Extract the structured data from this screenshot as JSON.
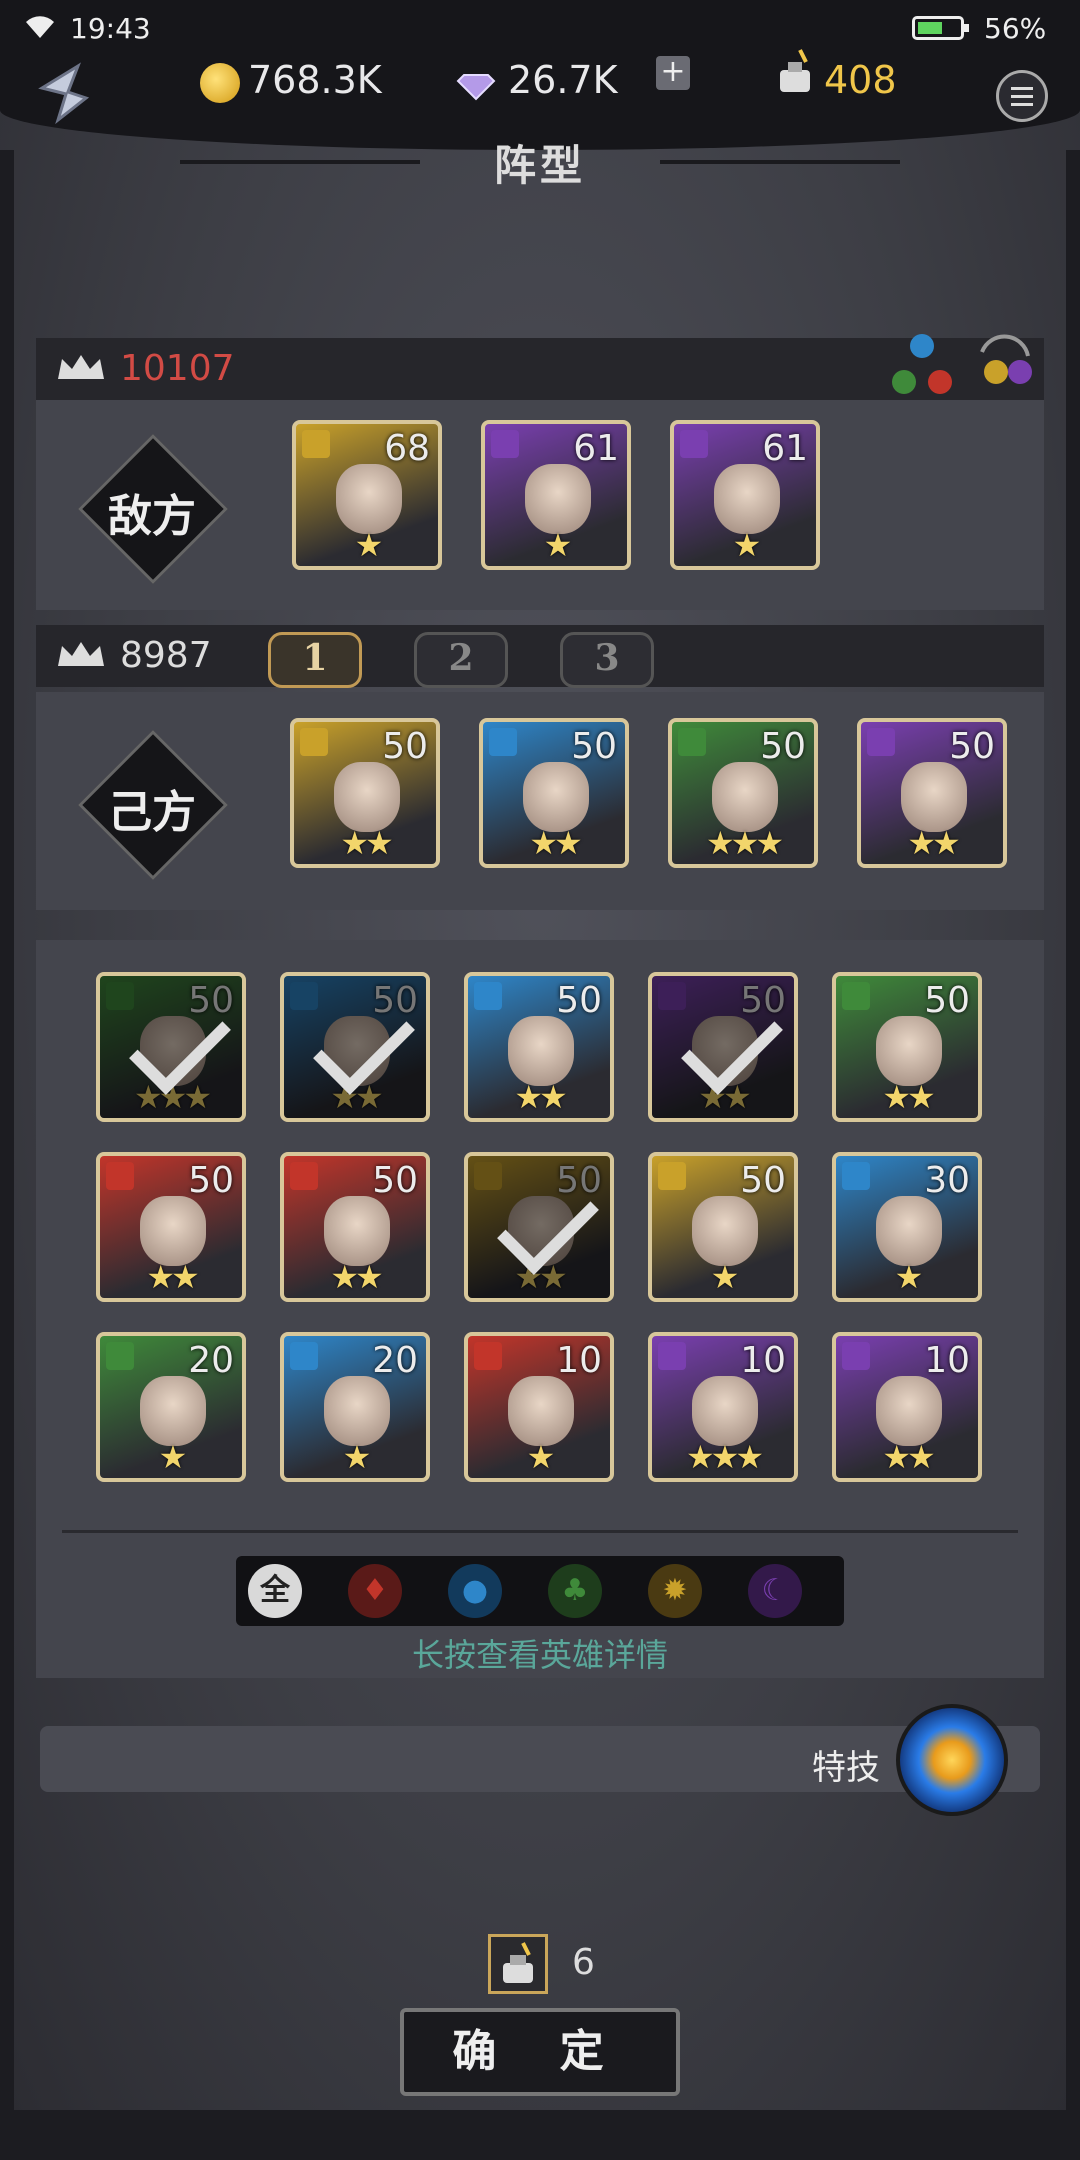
{
  "status_bar": {
    "time": "19:43",
    "battery": "56%"
  },
  "currency": {
    "gold": "768.3K",
    "gems": "26.7K",
    "ink": "408"
  },
  "page_title": "阵型",
  "enemy": {
    "label": "敌方",
    "power": "10107",
    "heroes": [
      {
        "level": "68",
        "stars": "★",
        "element": "light"
      },
      {
        "level": "61",
        "stars": "★",
        "element": "dark"
      },
      {
        "level": "61",
        "stars": "★",
        "element": "dark"
      }
    ]
  },
  "ally": {
    "label": "己方",
    "power": "8987",
    "team_tabs": [
      "1",
      "2",
      "3"
    ],
    "heroes": [
      {
        "level": "50",
        "stars": "★★",
        "element": "light"
      },
      {
        "level": "50",
        "stars": "★★",
        "element": "water"
      },
      {
        "level": "50",
        "stars": "★★★",
        "element": "nature"
      },
      {
        "level": "50",
        "stars": "★★",
        "element": "dark"
      }
    ]
  },
  "roster": [
    {
      "level": "50",
      "stars": "★★★",
      "element": "nature",
      "used": true
    },
    {
      "level": "50",
      "stars": "★★",
      "element": "water",
      "used": true
    },
    {
      "level": "50",
      "stars": "★★",
      "element": "water",
      "used": false
    },
    {
      "level": "50",
      "stars": "★★",
      "element": "dark",
      "used": true
    },
    {
      "level": "50",
      "stars": "★★",
      "element": "nature",
      "used": false
    },
    {
      "level": "50",
      "stars": "★★",
      "element": "fire",
      "used": false
    },
    {
      "level": "50",
      "stars": "★★",
      "element": "fire",
      "used": false
    },
    {
      "level": "50",
      "stars": "★★",
      "element": "light",
      "used": true
    },
    {
      "level": "50",
      "stars": "★",
      "element": "light",
      "used": false
    },
    {
      "level": "30",
      "stars": "★",
      "element": "water",
      "used": false
    },
    {
      "level": "20",
      "stars": "★",
      "element": "nature",
      "used": false
    },
    {
      "level": "20",
      "stars": "★",
      "element": "water",
      "used": false
    },
    {
      "level": "10",
      "stars": "★",
      "element": "fire",
      "used": false
    },
    {
      "level": "10",
      "stars": "★★★",
      "element": "dark",
      "used": false
    },
    {
      "level": "10",
      "stars": "★★",
      "element": "dark",
      "used": false
    }
  ],
  "filters": {
    "all_label": "全",
    "items": [
      "all",
      "fire",
      "water",
      "nature",
      "light",
      "dark"
    ]
  },
  "hint": "长按查看英雄详情",
  "skill": {
    "label": "特技"
  },
  "cost": "6",
  "confirm": "确 定",
  "colors": {
    "fire": "#c2352a",
    "water": "#2e86c9",
    "nature": "#3f8a3a",
    "light": "#c9a12a",
    "dark": "#7a3fb0",
    "power_enemy": "#d24b45"
  }
}
